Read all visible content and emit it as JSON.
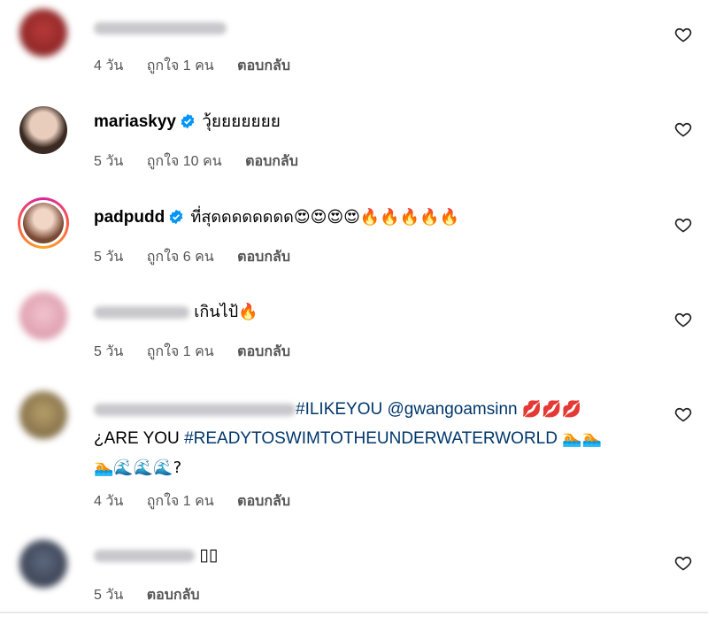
{
  "comments": [
    {
      "username": "",
      "text": "",
      "time": "4 วัน",
      "likes": "ถูกใจ 1 คน",
      "reply": "ตอบกลับ"
    },
    {
      "username": "mariaskyy",
      "text": "วุ้ยยยยยยย",
      "time": "5 วัน",
      "likes": "ถูกใจ 10 คน",
      "reply": "ตอบกลับ"
    },
    {
      "username": "padpudd",
      "text": "ที่สุดดดดดดดด😍😍😍😍🔥🔥🔥🔥🔥",
      "time": "5 วัน",
      "likes": "ถูกใจ 6 คน",
      "reply": "ตอบกลับ"
    },
    {
      "username": "",
      "text": "เกินไป้🔥",
      "time": "5 วัน",
      "likes": "ถูกใจ 1 คน",
      "reply": "ตอบกลับ"
    },
    {
      "username": "",
      "hashtag1": "#ILIKEYOU",
      "mention": "@gwangoamsinn",
      "lips": "💋💋💋",
      "text2_prefix": "¿ARE YOU",
      "hashtag2": "#READYTOSWIMTOTHEUNDERWATERWORLD",
      "swim1": "🏊🏊",
      "text3": "🏊🌊🌊🌊?",
      "time": "4 วัน",
      "likes": "ถูกใจ 1 คน",
      "reply": "ตอบกลับ"
    },
    {
      "username": "",
      "text": "▯▯",
      "time": "5 วัน",
      "reply": "ตอบกลับ"
    }
  ],
  "colors": {
    "hashtag": "#00376b",
    "meta": "#555555",
    "verified": "#0095f6"
  }
}
